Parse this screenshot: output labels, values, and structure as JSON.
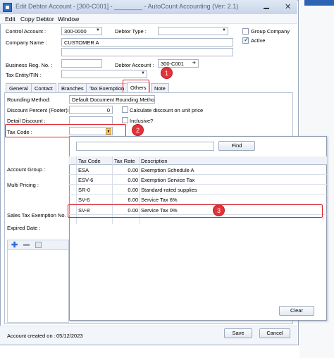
{
  "window": {
    "title": "Edit Debtor Account - [300-C001] - ________ - AutoCount Accounting (Ver: 2.1)",
    "close_glyph": "✕"
  },
  "menu": [
    "Edit",
    "Copy Debtor",
    "Window"
  ],
  "form": {
    "control_account_label": "Control Account :",
    "control_account_value": "300-0000",
    "debtor_type_label": "Debtor Type :",
    "debtor_type_value": "",
    "group_company_label": "Group Company",
    "group_company_checked": false,
    "active_label": "Active",
    "active_checked": true,
    "company_name_label": "Company Name :",
    "company_name_value": "CUSTOMER A",
    "company_name_line2": "",
    "business_reg_label": "Business Reg. No. :",
    "business_reg_value": "",
    "debtor_account_label": "Debtor Account :",
    "debtor_account_value": "300-C001",
    "debtor_account_plus": "+",
    "tax_entity_label": "Tax Entity/TIN :",
    "tax_entity_value": ""
  },
  "tabs": [
    {
      "label": "General",
      "active": false
    },
    {
      "label": "Contact",
      "active": false
    },
    {
      "label": "Branches",
      "active": false
    },
    {
      "label": "Tax Exemption",
      "active": false
    },
    {
      "label": "Others",
      "active": true
    },
    {
      "label": "Note",
      "active": false
    }
  ],
  "others": {
    "rounding_method_label": "Rounding Method:",
    "rounding_method_value": "Default Document Rounding Metho",
    "discount_percent_label": "Discount Percent (Footer):",
    "discount_percent_value": "0",
    "calc_discount_label": "Calculate discount on unit price",
    "detail_discount_label": "Detail Discount :",
    "inclusive_label": "Inclusive?",
    "tax_code_label": "Tax Code :",
    "tax_code_value": "",
    "account_group_label": "Account Group :",
    "multi_pricing_label": "Multi Pricing :",
    "sales_tax_exemption_label": "Sales Tax Exemption No. :",
    "expired_date_label": "Expired Date :"
  },
  "popup": {
    "search_value": "",
    "find_label": "Find",
    "columns": [
      "Tax Code",
      "Tax Rate",
      "Description"
    ],
    "rows": [
      {
        "code": "ESA",
        "rate": "0.00",
        "desc": "Exemption Schedule A"
      },
      {
        "code": "ESV-6",
        "rate": "0.00",
        "desc": "Exemption Service Tax"
      },
      {
        "code": "SR-0",
        "rate": "0.00",
        "desc": "Standard-rated supplies"
      },
      {
        "code": "SV-6",
        "rate": "6.00",
        "desc": "Service Tax 6%"
      },
      {
        "code": "SV-8",
        "rate": "0.00",
        "desc": "Service Tax 0%"
      }
    ],
    "clear_label": "Clear"
  },
  "annotations": [
    "1",
    "2",
    "3"
  ],
  "footer": {
    "account_created_label": "Account created on :",
    "account_created_value": "05/12/2023",
    "save_label": "Save",
    "cancel_label": "Cancel"
  },
  "colors": {
    "annotation_red": "#e0202a",
    "accent_blue": "#2c63b5"
  }
}
